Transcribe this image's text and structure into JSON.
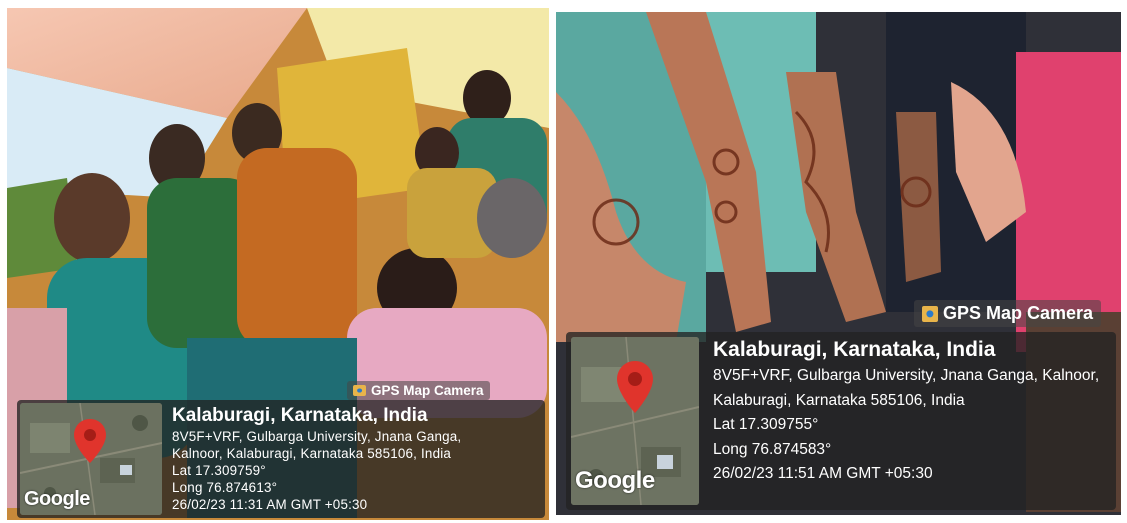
{
  "photos": [
    {
      "camera_label": "GPS Map Camera",
      "location_title": "Kalaburagi, Karnataka, India",
      "address_line1": "8V5F+VRF, Gulbarga University, Jnana Ganga,",
      "address_line2": "Kalnoor, Kalaburagi, Karnataka 585106, India",
      "latitude": "Lat 17.309759°",
      "longitude": "Long 76.874613°",
      "datetime": "26/02/23 11:31 AM GMT +05:30",
      "map_logo": "Google"
    },
    {
      "camera_label": "GPS Map Camera",
      "location_title": "Kalaburagi, Karnataka, India",
      "address_line1": "8V5F+VRF, Gulbarga University, Jnana Ganga, Kalnoor,",
      "address_line2": "Kalaburagi, Karnataka 585106, India",
      "latitude": "Lat 17.309755°",
      "longitude": "Long 76.874583°",
      "datetime": "26/02/23 11:51 AM GMT +05:30",
      "map_logo": "Google"
    }
  ],
  "colors": {
    "pin": "#e0342c",
    "overlay": "#232323",
    "camera_icon": "#e8b44a"
  },
  "icons": {
    "camera": "gps-map-camera-icon",
    "pin": "map-pin-icon"
  }
}
